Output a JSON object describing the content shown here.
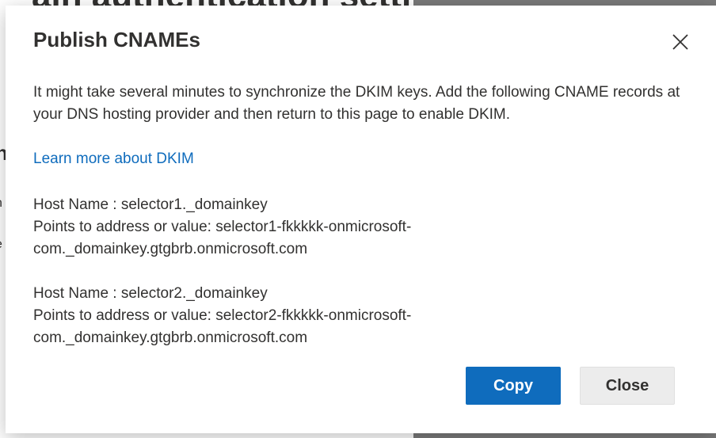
{
  "background": {
    "heading_fragment": "ain authentication setti",
    "frag_h": "h",
    "frag_n": "n",
    "frag_i": "i",
    "frag_e": "e",
    "frag_r": "r"
  },
  "dialog": {
    "title": "Publish CNAMEs",
    "description": "It might take several minutes to synchronize the DKIM keys. Add the following CNAME records at your DNS hosting provider and then return to this page to enable DKIM.",
    "learn_more_label": "Learn more about DKIM",
    "records": [
      {
        "host_line": "Host Name : selector1._domainkey",
        "value_line_1": "Points to address or value: selector1-fkkkkk-onmicrosoft-",
        "value_line_2": "com._domainkey.gtgbrb.onmicrosoft.com"
      },
      {
        "host_line": "Host Name : selector2._domainkey",
        "value_line_1": "Points to address or value: selector2-fkkkkk-onmicrosoft-",
        "value_line_2": "com._domainkey.gtgbrb.onmicrosoft.com"
      }
    ],
    "copy_label": "Copy",
    "close_label": "Close",
    "close_icon": "close-icon"
  },
  "colors": {
    "accent": "#0f6cbd",
    "text": "#323130",
    "secondary_button": "#ececec",
    "overlay": "#7a7a7a"
  }
}
